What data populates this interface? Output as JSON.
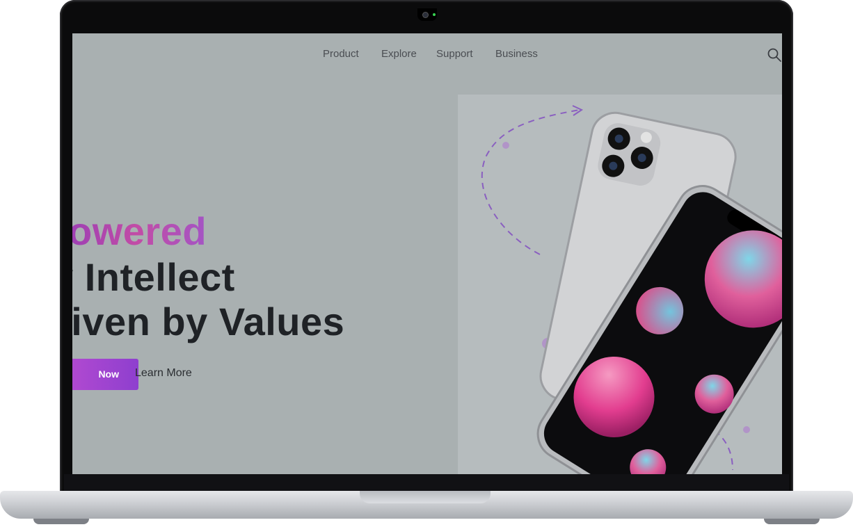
{
  "nav": {
    "items": [
      {
        "label": "Product"
      },
      {
        "label": "Explore"
      },
      {
        "label": "Support"
      },
      {
        "label": "Business"
      }
    ]
  },
  "hero": {
    "line1": "owered",
    "line2": "y Intellect",
    "line3": "riven by Values",
    "primary_cta": "Now",
    "secondary_cta": "Learn More"
  },
  "icons": {
    "search": "search-icon",
    "hero_visual": "smartphone-illustration"
  },
  "colors": {
    "accent": "#a046c8",
    "heading": "#1f2226",
    "screen_bg": "#a9b0b1"
  }
}
